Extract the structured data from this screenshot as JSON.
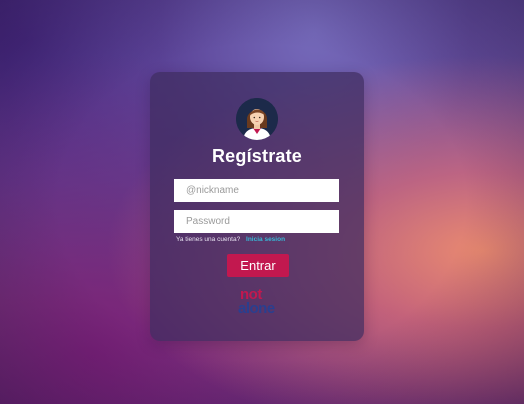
{
  "form": {
    "title": "Regístrate",
    "nickname_placeholder": "@nickname",
    "password_placeholder": "Password",
    "account_prompt": "Ya tienes una cuenta?",
    "login_link": "Inicia sesion",
    "submit_label": "Entrar"
  },
  "logo": {
    "line1": "not",
    "line2": "alone"
  },
  "colors": {
    "accent": "#c2184f",
    "link": "#37b7d6",
    "card": "#3e2c60",
    "logo_blue": "#2a3f8f"
  },
  "icons": {
    "avatar": "user-avatar-icon"
  }
}
